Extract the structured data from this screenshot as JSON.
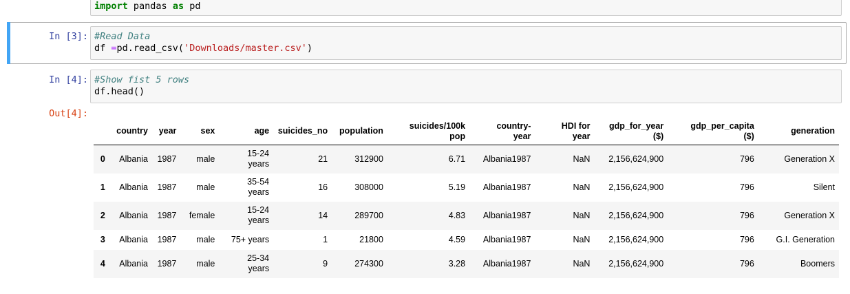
{
  "cells": {
    "top": {
      "code_kw1": "import",
      "code_mid": " pandas ",
      "code_kw2": "as",
      "code_end": " pd"
    },
    "in3": {
      "prompt": "In [3]:",
      "comment": "#Read Data",
      "line2_pre": "df ",
      "line2_op": "=",
      "line2_mid": "pd.read_csv(",
      "line2_str": "'Downloads/master.csv'",
      "line2_end": ")"
    },
    "in4": {
      "prompt": "In [4]:",
      "comment": "#Show fist 5 rows",
      "line2": "df.head()"
    },
    "out4": {
      "prompt": "Out[4]:"
    }
  },
  "table": {
    "headers": {
      "country": "country",
      "year": "year",
      "sex": "sex",
      "age": "age",
      "suicides_no": "suicides_no",
      "population": "population",
      "suicides_100k_l1": "suicides/100k",
      "suicides_100k_l2": "pop",
      "country_year_l1": "country-",
      "country_year_l2": "year",
      "hdi_l1": "HDI for",
      "hdi_l2": "year",
      "gdp_year_l1": "gdp_for_year",
      "gdp_year_l2": "($)",
      "gdp_capita_l1": "gdp_per_capita",
      "gdp_capita_l2": "($)",
      "generation": "generation"
    },
    "rows": [
      {
        "idx": "0",
        "country": "Albania",
        "year": "1987",
        "sex": "male",
        "age_l1": "15-24",
        "age_l2": "years",
        "suicides_no": "21",
        "population": "312900",
        "suicides_100k": "6.71",
        "country_year": "Albania1987",
        "hdi": "NaN",
        "gdp_year": "2,156,624,900",
        "gdp_capita": "796",
        "generation": "Generation X"
      },
      {
        "idx": "1",
        "country": "Albania",
        "year": "1987",
        "sex": "male",
        "age_l1": "35-54",
        "age_l2": "years",
        "suicides_no": "16",
        "population": "308000",
        "suicides_100k": "5.19",
        "country_year": "Albania1987",
        "hdi": "NaN",
        "gdp_year": "2,156,624,900",
        "gdp_capita": "796",
        "generation": "Silent"
      },
      {
        "idx": "2",
        "country": "Albania",
        "year": "1987",
        "sex": "female",
        "age_l1": "15-24",
        "age_l2": "years",
        "suicides_no": "14",
        "population": "289700",
        "suicides_100k": "4.83",
        "country_year": "Albania1987",
        "hdi": "NaN",
        "gdp_year": "2,156,624,900",
        "gdp_capita": "796",
        "generation": "Generation X"
      },
      {
        "idx": "3",
        "country": "Albania",
        "year": "1987",
        "sex": "male",
        "age_l1": "75+ years",
        "age_l2": "",
        "suicides_no": "1",
        "population": "21800",
        "suicides_100k": "4.59",
        "country_year": "Albania1987",
        "hdi": "NaN",
        "gdp_year": "2,156,624,900",
        "gdp_capita": "796",
        "generation": "G.I. Generation"
      },
      {
        "idx": "4",
        "country": "Albania",
        "year": "1987",
        "sex": "male",
        "age_l1": "25-34",
        "age_l2": "years",
        "suicides_no": "9",
        "population": "274300",
        "suicides_100k": "3.28",
        "country_year": "Albania1987",
        "hdi": "NaN",
        "gdp_year": "2,156,624,900",
        "gdp_capita": "796",
        "generation": "Boomers"
      }
    ]
  }
}
